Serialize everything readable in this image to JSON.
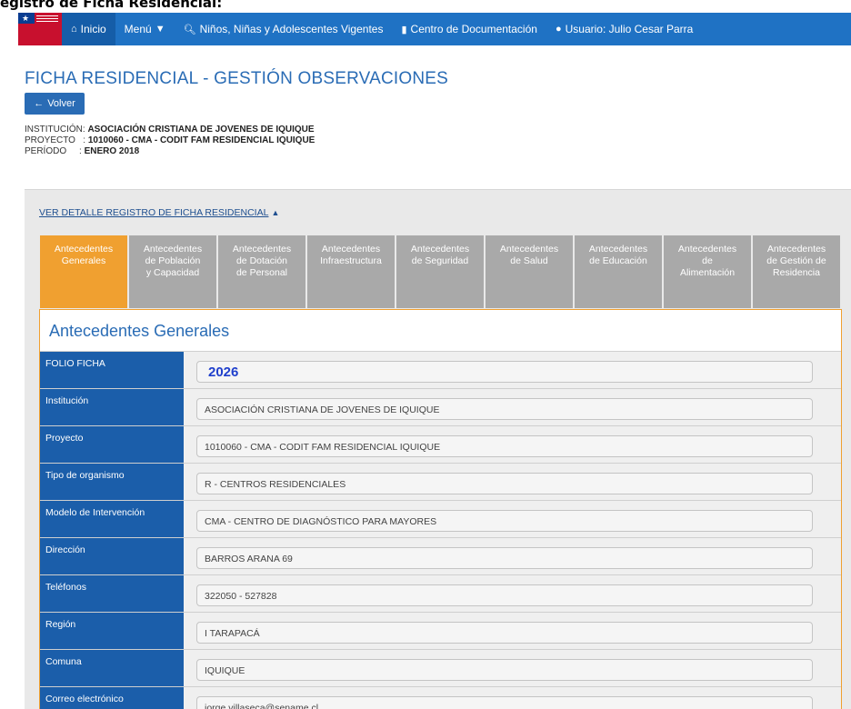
{
  "caption": "egistro de Ficha Residencial:",
  "nav": {
    "items": [
      {
        "label": "Inicio",
        "icon": "home-icon"
      },
      {
        "label": "Menú",
        "icon": "caret-down-icon"
      },
      {
        "label": "Niños, Niñas y Adolescentes Vigentes",
        "icon": "search-icon"
      },
      {
        "label": "Centro de Documentación",
        "icon": "file-icon"
      },
      {
        "label": "Usuario: Julio Cesar Parra",
        "icon": "user-icon"
      }
    ]
  },
  "page": {
    "title": "FICHA RESIDENCIAL - GESTIÓN OBSERVACIONES",
    "back_label": "Volver",
    "institution_label": "INSTITUCIÓN: ",
    "institution_value": "ASOCIACIÓN CRISTIANA DE JOVENES DE IQUIQUE",
    "project_label": "PROYECTO   : ",
    "project_value": "1010060 - CMA - CODIT FAM RESIDENCIAL IQUIQUE",
    "period_label": "PERÍODO     : ",
    "period_value": "ENERO 2018"
  },
  "detail_link": "VER DETALLE REGISTRO DE FICHA RESIDENCIAL",
  "tabs": [
    {
      "line1": "Antecedentes",
      "line2": "Generales",
      "line3": ""
    },
    {
      "line1": "Antecedentes",
      "line2": "de Población",
      "line3": "y Capacidad"
    },
    {
      "line1": "Antecedentes",
      "line2": "de Dotación",
      "line3": "de Personal"
    },
    {
      "line1": "Antecedentes",
      "line2": "Infraestructura",
      "line3": ""
    },
    {
      "line1": "Antecedentes",
      "line2": "de Seguridad",
      "line3": ""
    },
    {
      "line1": "Antecedentes",
      "line2": "de Salud",
      "line3": ""
    },
    {
      "line1": "Antecedentes",
      "line2": "de Educación",
      "line3": ""
    },
    {
      "line1": "Antecedentes",
      "line2": "de",
      "line3": "Alimentación"
    },
    {
      "line1": "Antecedentes",
      "line2": "de Gestión de",
      "line3": "Residencia"
    }
  ],
  "section_title": "Antecedentes Generales",
  "fields": [
    {
      "label": "FOLIO FICHA",
      "value": "2026"
    },
    {
      "label": "Institución",
      "value": "ASOCIACIÓN CRISTIANA DE JOVENES DE IQUIQUE"
    },
    {
      "label": "Proyecto",
      "value": "1010060 - CMA - CODIT FAM RESIDENCIAL IQUIQUE"
    },
    {
      "label": "Tipo de organismo",
      "value": "R - CENTROS RESIDENCIALES"
    },
    {
      "label": "Modelo de Intervención",
      "value": "CMA - CENTRO DE DIAGNÓSTICO PARA MAYORES"
    },
    {
      "label": "Dirección",
      "value": "BARROS ARANA 69"
    },
    {
      "label": "Teléfonos",
      "value": "322050 - 527828"
    },
    {
      "label": "Región",
      "value": "I TARAPACÁ"
    },
    {
      "label": "Comuna",
      "value": "IQUIQUE"
    },
    {
      "label": "Correo electrónico",
      "value": "jorge.villaseca@sename.cl"
    }
  ],
  "colors": {
    "nav": "#1f72c4",
    "accent": "#f0a030",
    "label_bg": "#1b5eaa",
    "title": "#2a6cb5"
  }
}
